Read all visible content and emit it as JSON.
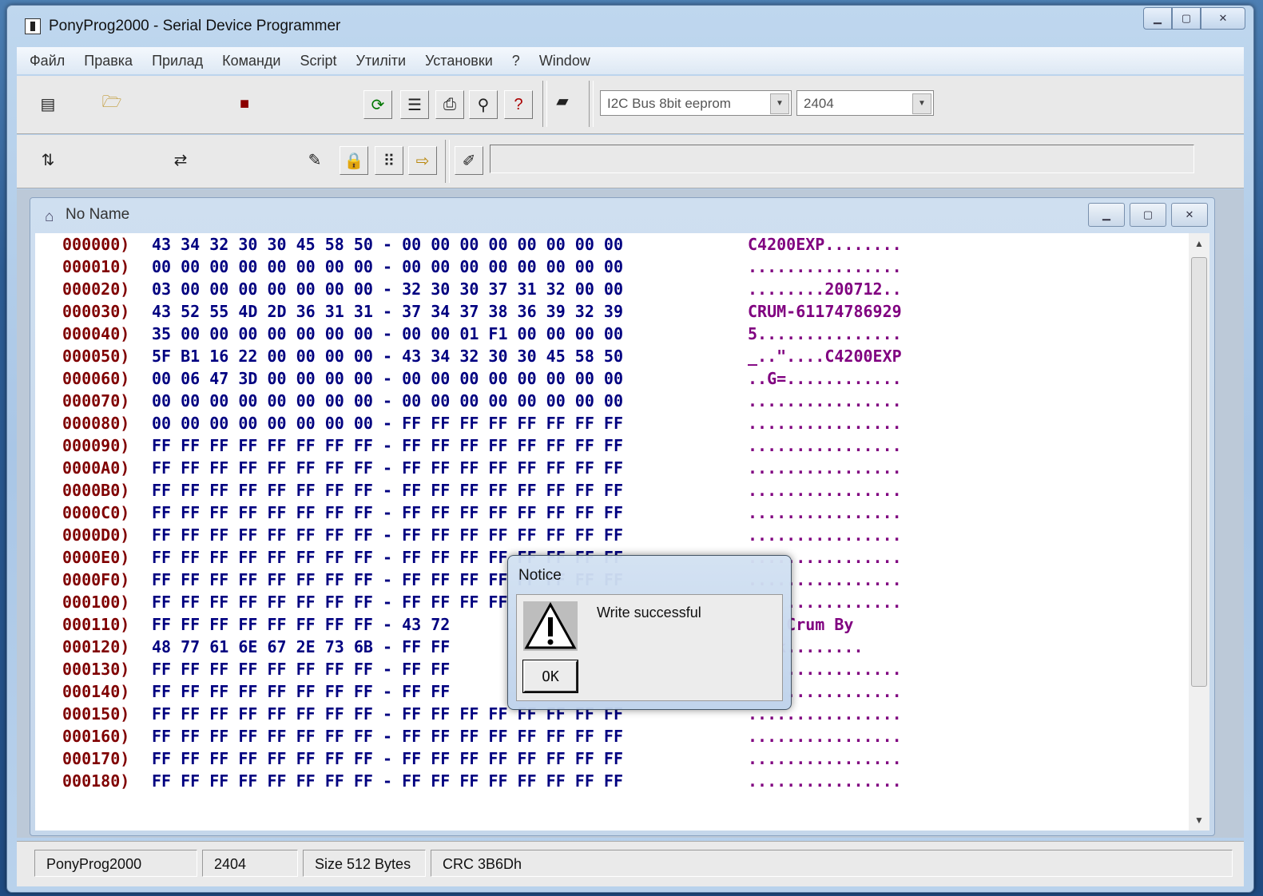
{
  "window": {
    "title": "PonyProg2000 - Serial Device Programmer"
  },
  "menu": [
    "Файл",
    "Правка",
    "Прилад",
    "Команди",
    "Script",
    "Утиліти",
    "Установки",
    "?",
    "Window"
  ],
  "toolbar": {
    "device_family": "I2C Bus 8bit eeprom",
    "device_type": "2404",
    "note": ""
  },
  "document": {
    "title": "No Name"
  },
  "hex_rows": [
    {
      "addr": "000000)",
      "hex": "43 34 32 30 30 45 58 50 - 00 00 00 00 00 00 00 00",
      "ascii": "C4200EXP........"
    },
    {
      "addr": "000010)",
      "hex": "00 00 00 00 00 00 00 00 - 00 00 00 00 00 00 00 00",
      "ascii": "................"
    },
    {
      "addr": "000020)",
      "hex": "03 00 00 00 00 00 00 00 - 32 30 30 37 31 32 00 00",
      "ascii": "........200712.."
    },
    {
      "addr": "000030)",
      "hex": "43 52 55 4D 2D 36 31 31 - 37 34 37 38 36 39 32 39",
      "ascii": "CRUM-61174786929"
    },
    {
      "addr": "000040)",
      "hex": "35 00 00 00 00 00 00 00 - 00 00 01 F1 00 00 00 00",
      "ascii": "5..............."
    },
    {
      "addr": "000050)",
      "hex": "5F B1 16 22 00 00 00 00 - 43 34 32 30 30 45 58 50",
      "ascii": "_..\"....C4200EXP"
    },
    {
      "addr": "000060)",
      "hex": "00 06 47 3D 00 00 00 00 - 00 00 00 00 00 00 00 00",
      "ascii": "..G=............"
    },
    {
      "addr": "000070)",
      "hex": "00 00 00 00 00 00 00 00 - 00 00 00 00 00 00 00 00",
      "ascii": "................"
    },
    {
      "addr": "000080)",
      "hex": "00 00 00 00 00 00 00 00 - FF FF FF FF FF FF FF FF",
      "ascii": "................"
    },
    {
      "addr": "000090)",
      "hex": "FF FF FF FF FF FF FF FF - FF FF FF FF FF FF FF FF",
      "ascii": "................"
    },
    {
      "addr": "0000A0)",
      "hex": "FF FF FF FF FF FF FF FF - FF FF FF FF FF FF FF FF",
      "ascii": "................"
    },
    {
      "addr": "0000B0)",
      "hex": "FF FF FF FF FF FF FF FF - FF FF FF FF FF FF FF FF",
      "ascii": "................"
    },
    {
      "addr": "0000C0)",
      "hex": "FF FF FF FF FF FF FF FF - FF FF FF FF FF FF FF FF",
      "ascii": "................"
    },
    {
      "addr": "0000D0)",
      "hex": "FF FF FF FF FF FF FF FF - FF FF FF FF FF FF FF FF",
      "ascii": "................"
    },
    {
      "addr": "0000E0)",
      "hex": "FF FF FF FF FF FF FF FF - FF FF FF FF FF FF FF FF",
      "ascii": "................"
    },
    {
      "addr": "0000F0)",
      "hex": "FF FF FF FF FF FF FF FF - FF FF FF FF FF FF FF FF",
      "ascii": "................"
    },
    {
      "addr": "000100)",
      "hex": "FF FF FF FF FF FF FF FF - FF FF FF FF FF FF FF FF",
      "ascii": "................"
    },
    {
      "addr": "000110)",
      "hex": "FF FF FF FF FF FF FF FF - 43 72",
      "ascii": "....Crum By"
    },
    {
      "addr": "000120)",
      "hex": "48 77 61 6E 67 2E 73 6B - FF FF",
      "ascii": "g.sk........"
    },
    {
      "addr": "000130)",
      "hex": "FF FF FF FF FF FF FF FF - FF FF",
      "ascii": "................"
    },
    {
      "addr": "000140)",
      "hex": "FF FF FF FF FF FF FF FF - FF FF",
      "ascii": "................"
    },
    {
      "addr": "000150)",
      "hex": "FF FF FF FF FF FF FF FF - FF FF FF FF FF FF FF FF",
      "ascii": "................"
    },
    {
      "addr": "000160)",
      "hex": "FF FF FF FF FF FF FF FF - FF FF FF FF FF FF FF FF",
      "ascii": "................"
    },
    {
      "addr": "000170)",
      "hex": "FF FF FF FF FF FF FF FF - FF FF FF FF FF FF FF FF",
      "ascii": "................"
    },
    {
      "addr": "000180)",
      "hex": "FF FF FF FF FF FF FF FF - FF FF FF FF FF FF FF FF",
      "ascii": "................"
    }
  ],
  "dialog": {
    "title": "Notice",
    "message": "Write successful",
    "ok_label": "OK",
    "icon": "warning-icon"
  },
  "status": {
    "app": "PonyProg2000",
    "device": "2404",
    "size": "Size  512 Bytes",
    "crc": "CRC  3B6Dh"
  },
  "colors": {
    "addr": "#800000",
    "hex": "#000080",
    "ascii": "#800080"
  }
}
